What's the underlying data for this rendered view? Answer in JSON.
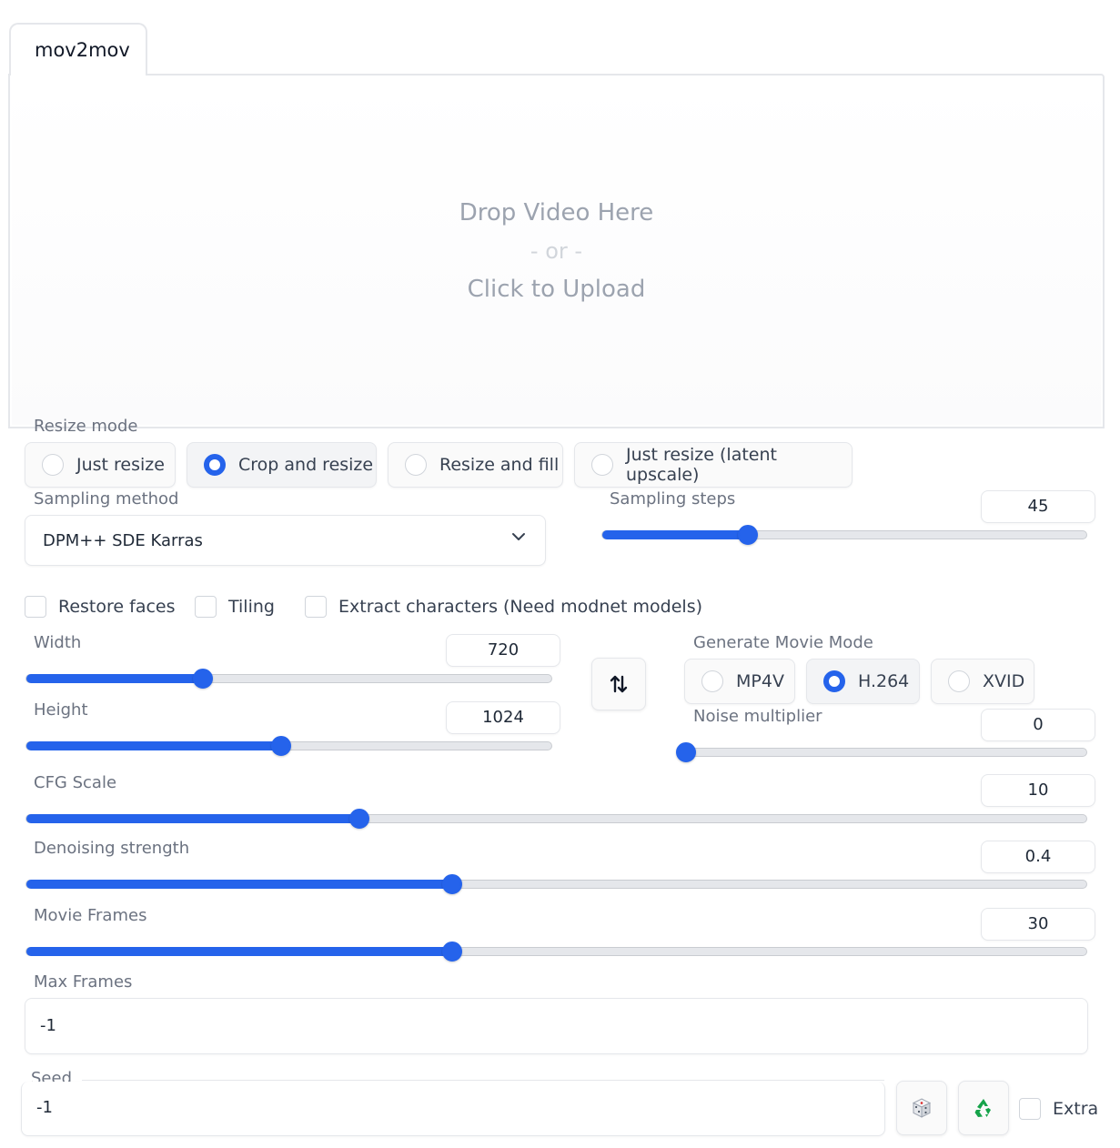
{
  "tab": {
    "label": "mov2mov"
  },
  "upload": {
    "line1": "Drop Video Here",
    "line2": "- or -",
    "line3": "Click to Upload"
  },
  "resize_mode": {
    "label": "Resize mode",
    "options": [
      "Just resize",
      "Crop and resize",
      "Resize and fill",
      "Just resize (latent upscale)"
    ],
    "selected": "Crop and resize"
  },
  "sampling_method": {
    "label": "Sampling method",
    "value": "DPM++ SDE Karras"
  },
  "sampling_steps": {
    "label": "Sampling steps",
    "value": "45",
    "fraction": 0.3
  },
  "checkboxes": {
    "restore_faces": "Restore faces",
    "tiling": "Tiling",
    "extract_characters": "Extract characters (Need modnet models)"
  },
  "width": {
    "label": "Width",
    "value": "720",
    "fraction": 0.337
  },
  "height": {
    "label": "Height",
    "value": "1024",
    "fraction": 0.485
  },
  "swap_icon": "swap-vertical-arrows",
  "movie_mode": {
    "label": "Generate Movie Mode",
    "options": [
      "MP4V",
      "H.264",
      "XVID"
    ],
    "selected": "H.264"
  },
  "noise_multiplier": {
    "label": "Noise multiplier",
    "value": "0",
    "fraction": 0.0
  },
  "cfg_scale": {
    "label": "CFG Scale",
    "value": "10",
    "fraction": 0.314
  },
  "denoising_strength": {
    "label": "Denoising strength",
    "value": "0.4",
    "fraction": 0.402
  },
  "movie_frames": {
    "label": "Movie Frames",
    "value": "30",
    "fraction": 0.402
  },
  "max_frames": {
    "label": "Max Frames",
    "value": "-1"
  },
  "seed": {
    "label": "Seed",
    "value": "-1",
    "dice_icon": "dice-icon",
    "recycle_icon": "recycle-icon",
    "extra_label": "Extra"
  },
  "colors": {
    "accent": "#2563eb",
    "track": "#e5e7eb",
    "border": "#e5e7eb",
    "label": "#6b7280"
  }
}
